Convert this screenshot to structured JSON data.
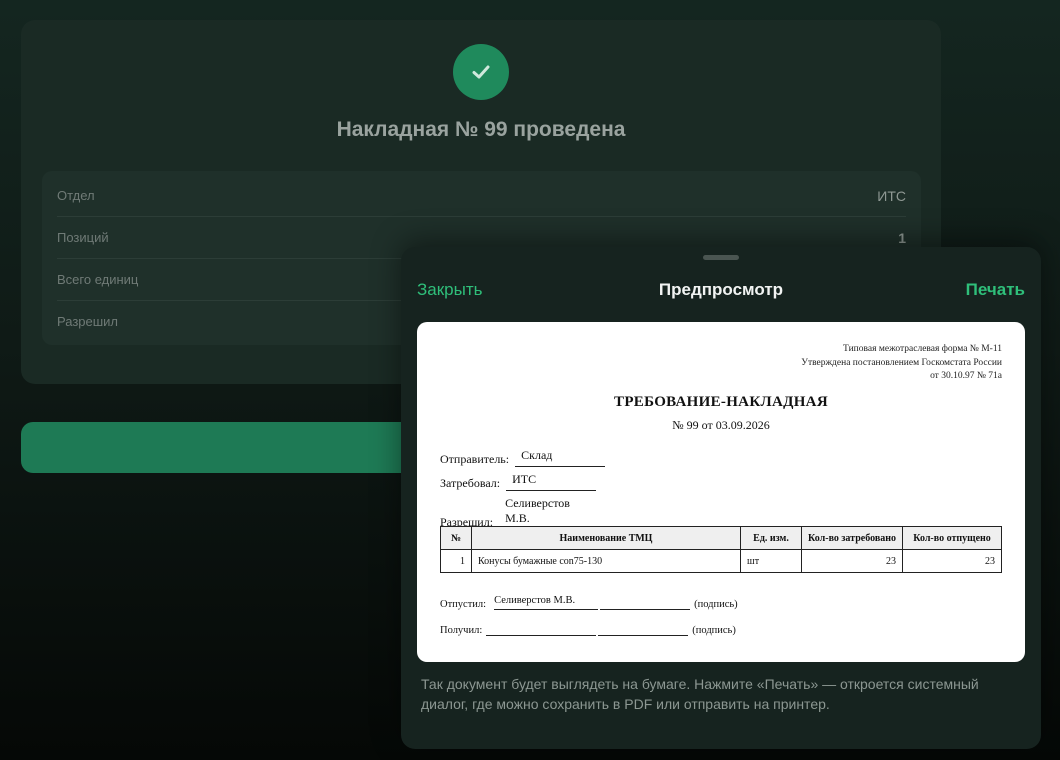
{
  "background": {
    "title": "Накладная № 99 проведена",
    "rows": [
      {
        "label": "Отдел",
        "value": "ИТС"
      },
      {
        "label": "Позиций",
        "value": "1"
      },
      {
        "label": "Всего единиц",
        "value": ""
      },
      {
        "label": "Разрешил",
        "value": ""
      }
    ]
  },
  "sheet": {
    "close_label": "Закрыть",
    "title": "Предпросмотр",
    "print_label": "Печать",
    "hint": "Так документ будет выглядеть на бумаге. Нажмите «Печать» — откроется системный диалог, где можно сохранить в PDF или отправить на принтер."
  },
  "document": {
    "form_note": [
      "Типовая межотраслевая форма № М-11",
      "Утверждена постановлением Госкомстата России",
      "от 30.10.97 № 71а"
    ],
    "title": "ТРЕБОВАНИЕ-НАКЛАДНАЯ",
    "number_line": "№ 99 от 03.09.2026",
    "fields": {
      "sender_label": "Отправитель:",
      "sender_value": "Склад",
      "requester_label": "Затребовал:",
      "requester_value": "ИТС",
      "approver_label": "Разрешил:",
      "approver_value": "Селиверстов М.В."
    },
    "table": {
      "headers": [
        "№",
        "Наименование ТМЦ",
        "Ед. изм.",
        "Кол-во затребовано",
        "Кол-во отпущено"
      ],
      "rows": [
        {
          "n": "1",
          "name": "Конусы бумажные con75-130",
          "unit": "шт",
          "requested": "23",
          "released": "23"
        }
      ]
    },
    "signatures": {
      "released_label": "Отпустил:",
      "released_name": "Селиверстов М.В.",
      "released_sign": "(подпись)",
      "received_label": "Получил:",
      "received_sign": "(подпись)"
    }
  },
  "colors": {
    "accent": "#2fbf7a",
    "success": "#1f8a5c",
    "button": "#1e7a55"
  },
  "icons": {
    "status": "check-icon"
  }
}
